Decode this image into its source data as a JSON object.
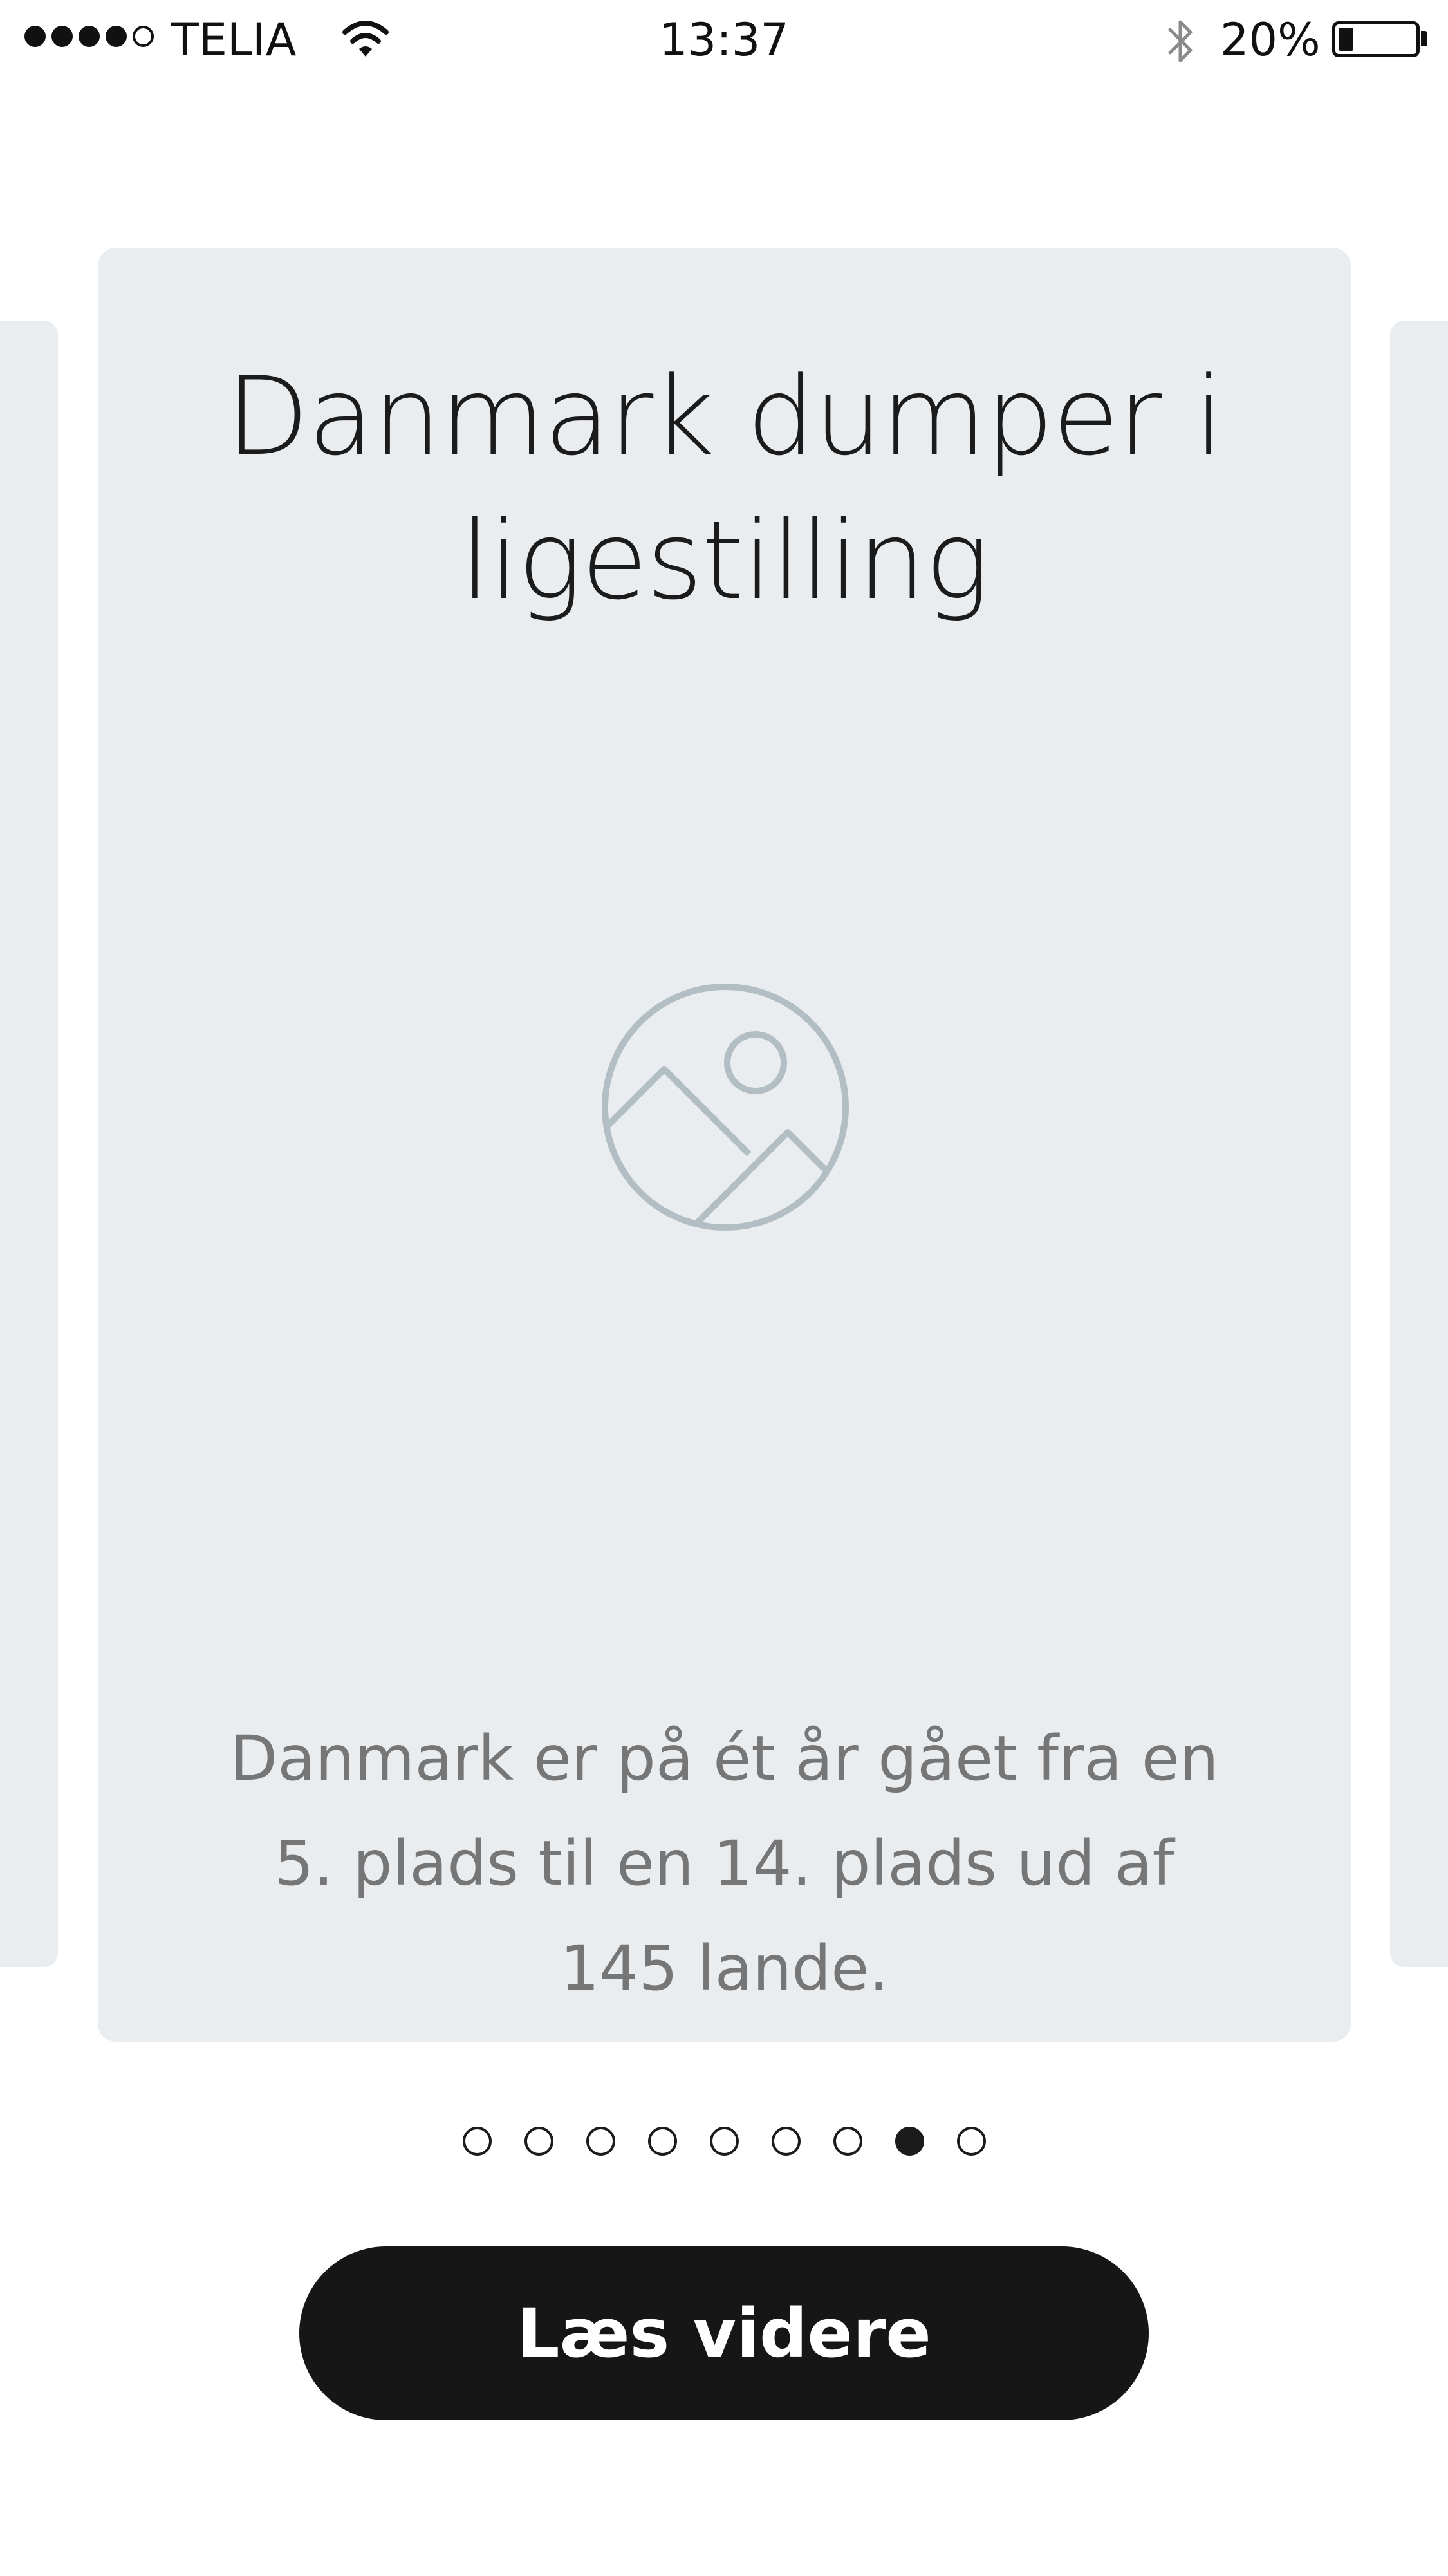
{
  "status_bar": {
    "carrier": "TELIA",
    "time": "13:37",
    "battery_percent": "20%",
    "battery_level": 0.2,
    "signal_bars_filled": 4,
    "signal_bars_total": 5,
    "icons": [
      "signal-dots-icon",
      "wifi-icon",
      "bluetooth-icon",
      "battery-icon"
    ]
  },
  "card": {
    "title": "Danmark dumper i ligestilling",
    "image_placeholder_icon": "image-placeholder-icon",
    "body": "Danmark er på ét år gået fra en 5. plads til en 14. plads ud af 145 lande."
  },
  "pagination": {
    "total": 9,
    "active_index": 7
  },
  "cta": {
    "label": "Læs videre"
  },
  "colors": {
    "card_background": "#eaedf0",
    "button_background": "#161616",
    "icon_stroke": "#b3bdc4",
    "body_text": "#767676"
  }
}
